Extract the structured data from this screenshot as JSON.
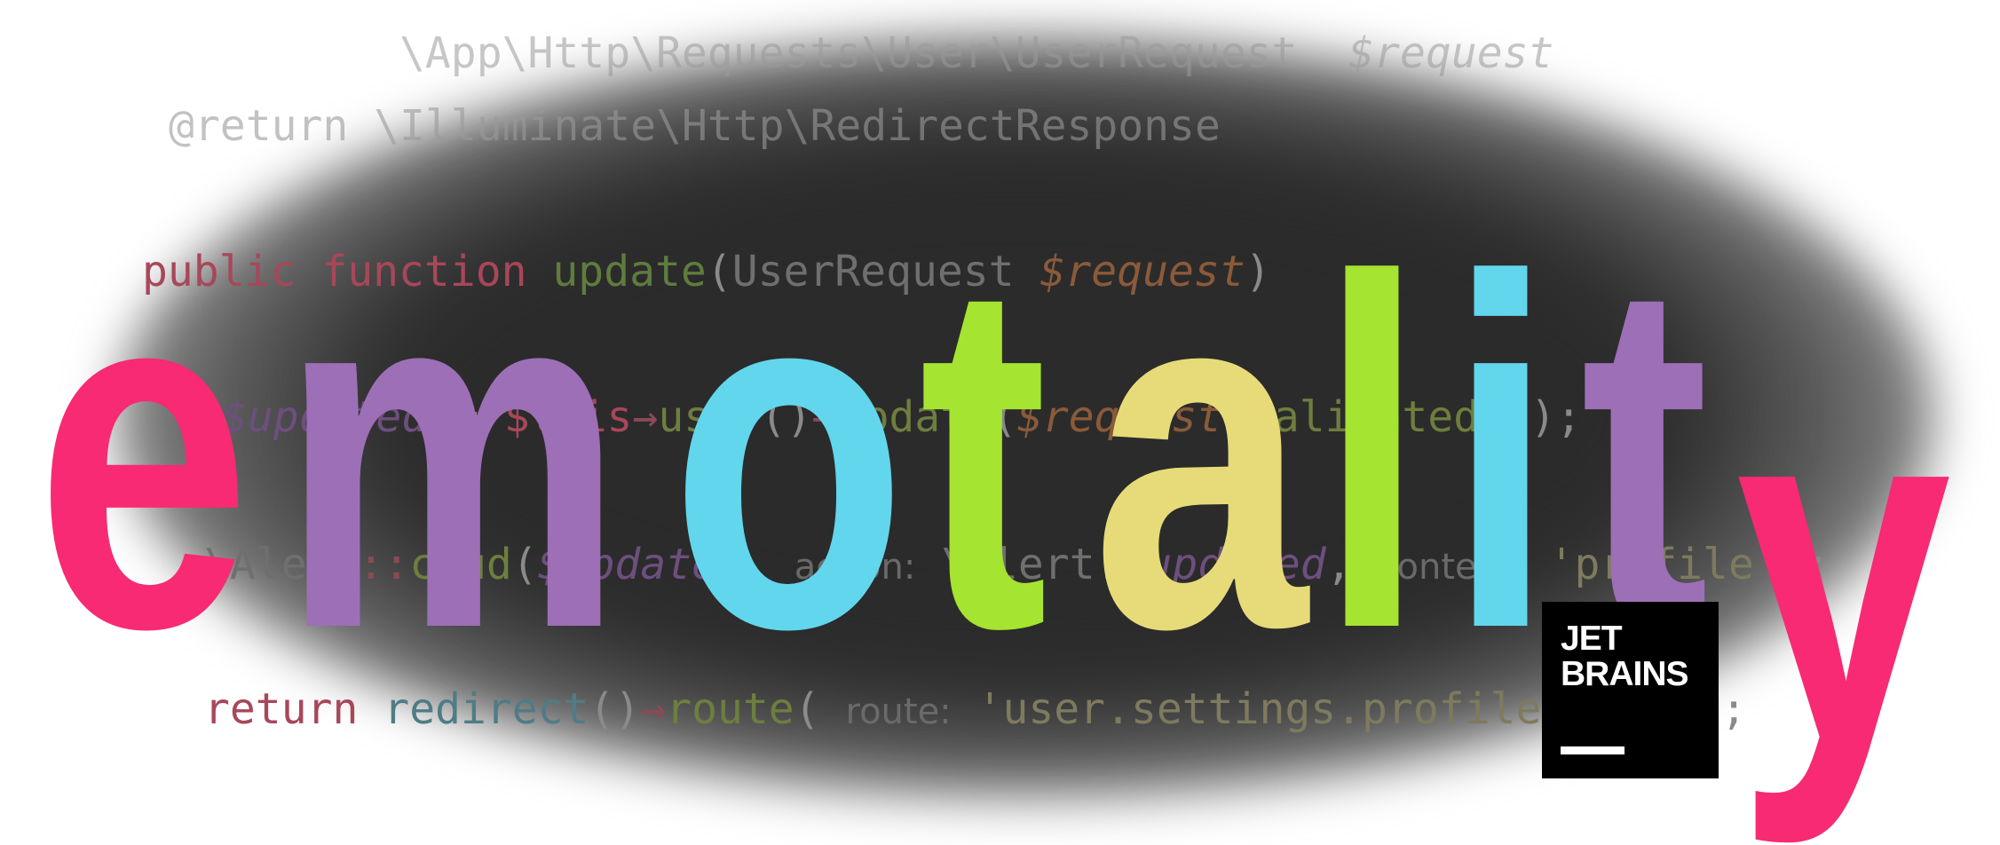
{
  "brand_word": {
    "letters": [
      {
        "char": "e",
        "color": "#f72a73"
      },
      {
        "char": "m",
        "color": "#9d6fb6"
      },
      {
        "char": "o",
        "color": "#62d6ec"
      },
      {
        "char": "t",
        "color": "#a5e430"
      },
      {
        "char": "a",
        "color": "#e6db78"
      },
      {
        "char": "l",
        "color": "#a5e430"
      },
      {
        "char": "i",
        "color": "#62d6ec"
      },
      {
        "char": "t",
        "color": "#9d6fb6"
      },
      {
        "char": "y",
        "color": "#f72a73"
      }
    ]
  },
  "code": {
    "line1": {
      "type": "\\App\\Http\\Requests\\User\\UserRequest",
      "var": "$request"
    },
    "line2": {
      "tag": "@return",
      "type": "\\Illuminate\\Http\\RedirectResponse"
    },
    "line3": {
      "kw": "public",
      "kw2": "function",
      "fn": "update",
      "open": "(",
      "cls": "UserRequest",
      "var": "$request",
      "close": ")"
    },
    "line4": {
      "var": "$updated",
      "eq": "=",
      "self": "$this",
      "arrow": "→",
      "user": "user",
      "call": "()",
      "method": "update",
      "open": "(",
      "var2": "$request",
      "arrow2": "→",
      "method2": "validated",
      "close": "());"
    },
    "line5": {
      "cls": "\\Alert",
      "sep": "::",
      "fn": "crud",
      "open": "(",
      "var": "$updated",
      "comma": ",",
      "hint": "action:",
      "cls2": "\\Alert",
      "sep2": "::",
      "const": "updated",
      "comma2": ",",
      "hint2": "context:",
      "str": "'profile'",
      "close": ");"
    },
    "line6": {
      "kw": "return",
      "fn": "redirect",
      "call": "()",
      "arrow": "→",
      "method": "route",
      "open": "(",
      "hint": "route:",
      "str": "'user.settings.profile.view'",
      "close": ");"
    }
  },
  "logo": {
    "line1": "JET",
    "line2": "BRAINS"
  }
}
